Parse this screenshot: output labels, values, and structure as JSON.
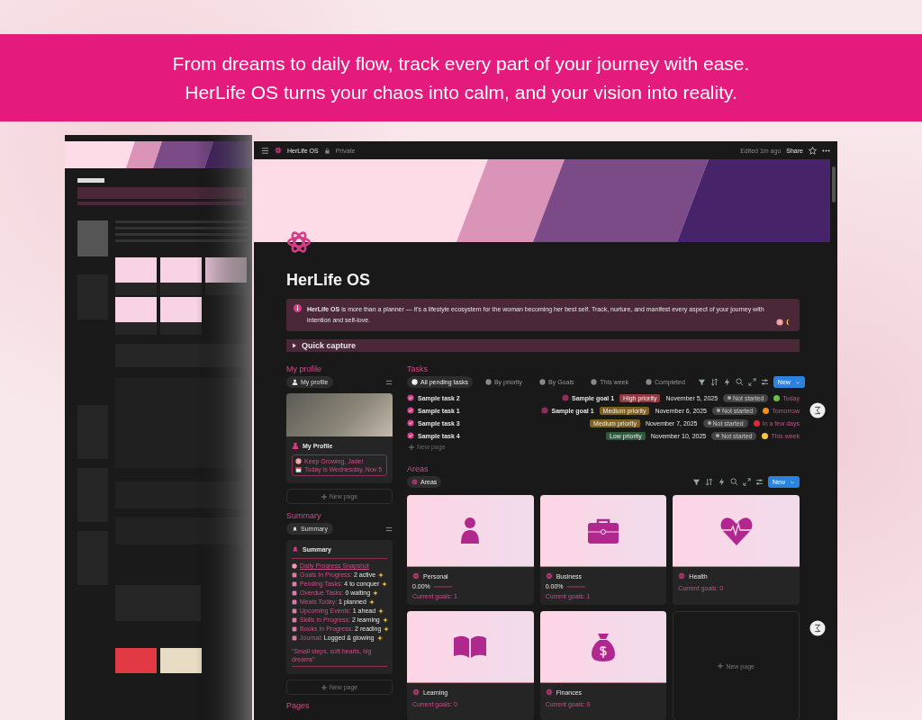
{
  "banner": {
    "lines": [
      "From dreams to daily flow, track every part of your journey with ease.",
      "HerLife OS turns your chaos into calm, and your vision into reality."
    ]
  },
  "topbar": {
    "title": "HerLife OS",
    "visibility": "Private",
    "edited": "Edited 1m ago",
    "share": "Share"
  },
  "page": {
    "title": "HerLife OS",
    "callout": "**HerLife OS** is more than a planner — it's a lifestyle ecosystem for the woman becoming her best self. Track, nurture, and manifest every aspect of your journey with intention and self-love.",
    "toggle": "Quick capture"
  },
  "profile": {
    "heading": "My profile",
    "view": "My profile",
    "card_title": "My Profile",
    "lines": [
      "Keep Growing, Jade!",
      "Today is Wednesday, Nov 5"
    ],
    "new_page": "New page"
  },
  "summary": {
    "heading": "Summary",
    "view": "Summary",
    "card_title": "Summary",
    "snapshot": "Daily Progress Snapshot",
    "items": [
      {
        "label": "Goals In Progress:",
        "value": "2 active"
      },
      {
        "label": "Pending Tasks:",
        "value": "4 to conquer"
      },
      {
        "label": "Overdue Tasks:",
        "value": "0 waiting"
      },
      {
        "label": "Meals Today:",
        "value": "1 planned"
      },
      {
        "label": "Upcoming Events:",
        "value": "1 ahead"
      },
      {
        "label": "Skills In Progress:",
        "value": "2 learning"
      },
      {
        "label": "Books In Progress:",
        "value": "2 reading"
      },
      {
        "label": "Journal:",
        "value": "Logged & glowing"
      }
    ],
    "quote": "\"Small steps, soft hearts, big dreams\"",
    "new_page": "New page"
  },
  "pages": {
    "heading": "Pages"
  },
  "tasks": {
    "heading": "Tasks",
    "new_button": "New",
    "views": [
      {
        "label": "All pending tasks",
        "selected": true
      },
      {
        "label": "By priority",
        "selected": false
      },
      {
        "label": "By Goals",
        "selected": false
      },
      {
        "label": "This week",
        "selected": false
      },
      {
        "label": "Completed",
        "selected": false
      }
    ],
    "rows": [
      {
        "name": "Sample task 2",
        "goal": "Sample goal 1",
        "priority": {
          "label": "High priority",
          "color": "#8e3c3e"
        },
        "date": "November 5, 2025",
        "status": "Not started",
        "due": {
          "label": "Today",
          "color": "#6bbd45"
        }
      },
      {
        "name": "Sample task 1",
        "goal": "Sample goal 1",
        "priority": {
          "label": "Medium priority",
          "color": "#7f5f22"
        },
        "date": "November 6, 2025",
        "status": "Not started",
        "due": {
          "label": "Tomorrow",
          "color": "#f28c1c"
        }
      },
      {
        "name": "Sample task 3",
        "priority": {
          "label": "Medium priority",
          "color": "#7f5f22"
        },
        "date": "November 7, 2025",
        "status": "Not started",
        "due": {
          "label": "In a few days",
          "color": "#e3253b"
        }
      },
      {
        "name": "Sample task 4",
        "priority": {
          "label": "Low priority",
          "color": "#2d5a3c"
        },
        "date": "November 10, 2025",
        "status": "Not started",
        "due": {
          "label": "This week",
          "color": "#f4c745"
        }
      }
    ],
    "new_page": "New page"
  },
  "areas": {
    "heading": "Areas",
    "view": "Areas",
    "new_button": "New",
    "new_page": "New page",
    "cards": [
      {
        "name": "Personal",
        "kind": "person",
        "progress": "0.00%",
        "level": 0,
        "goals": "Current goals: 1"
      },
      {
        "name": "Business",
        "kind": "briefcase",
        "progress": "0.00%",
        "level": 0,
        "goals": "Current goals: 1"
      },
      {
        "name": "Health",
        "kind": "heart",
        "goals": "Current goals: 0"
      },
      {
        "name": "Learning",
        "kind": "book",
        "goals": "Current goals: 0"
      },
      {
        "name": "Finances",
        "kind": "moneybag",
        "goals": "Current goals: 0"
      }
    ]
  }
}
